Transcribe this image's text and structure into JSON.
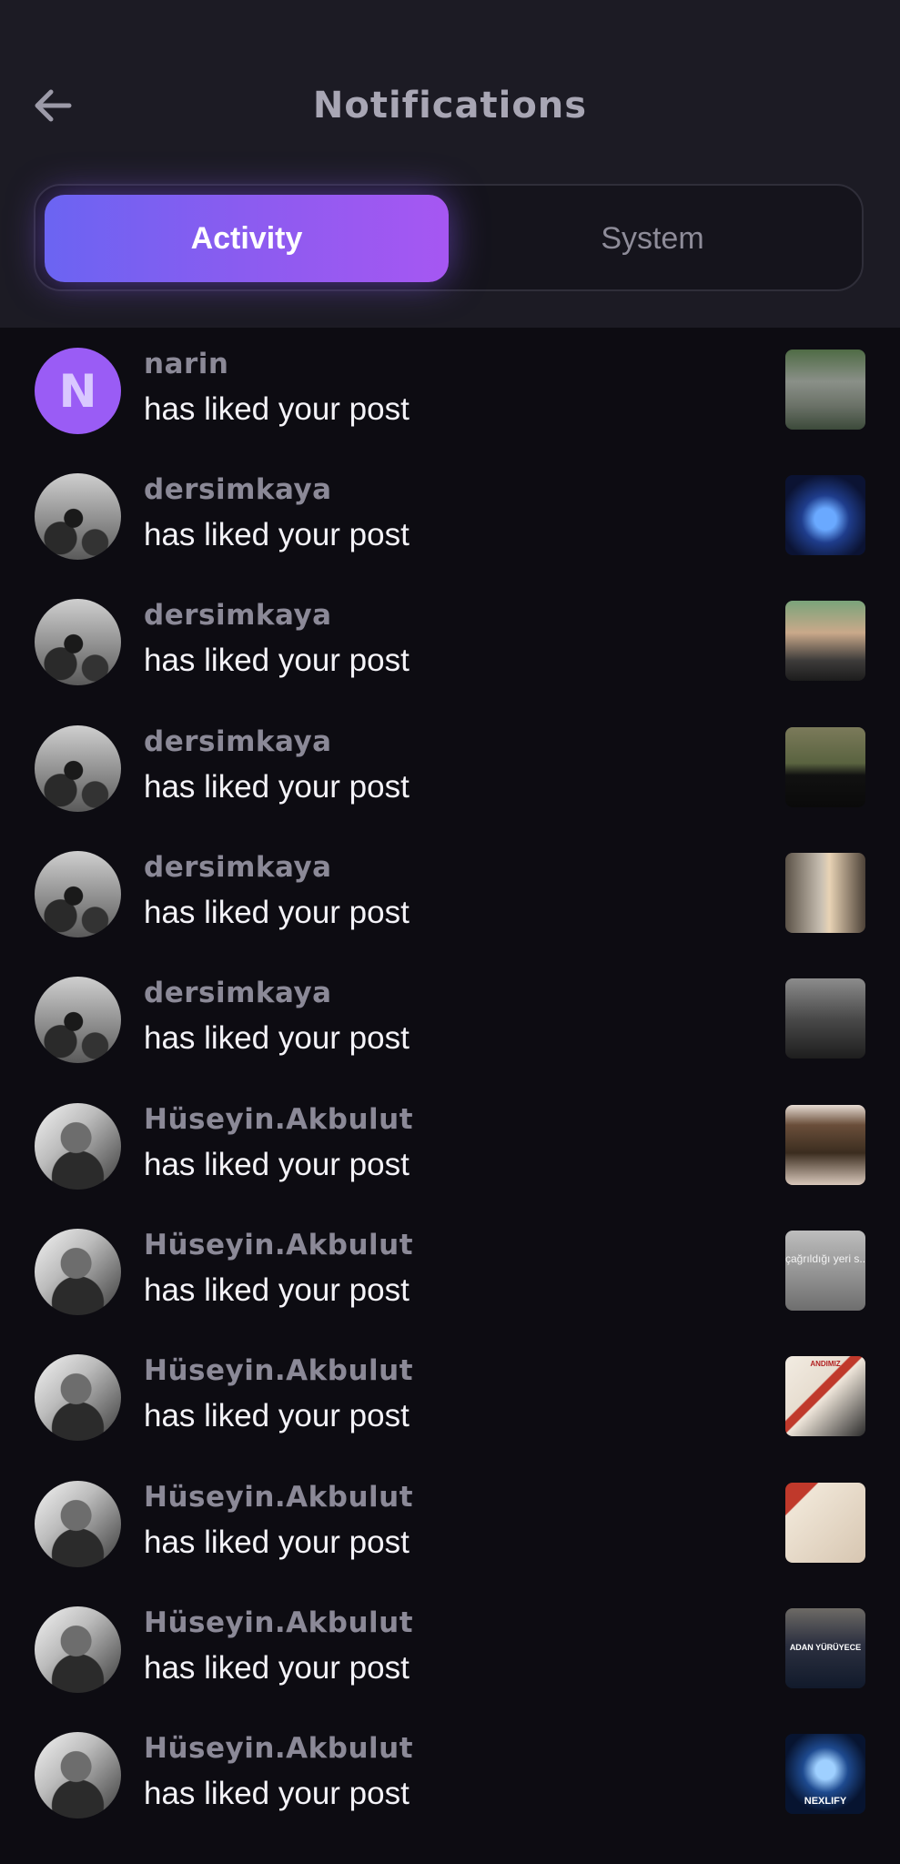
{
  "header": {
    "title": "Notifications",
    "back_icon": "arrow-left-icon"
  },
  "tabs": [
    {
      "label": "Activity",
      "active": true
    },
    {
      "label": "System",
      "active": false
    }
  ],
  "colors": {
    "accent_start": "#6b64f2",
    "accent_end": "#a657f2",
    "background": "#0d0c12",
    "header_background": "#1c1b24",
    "username": "#8b8997",
    "action_text": "#f4f3f8"
  },
  "notifications": [
    {
      "username": "narin",
      "avatar_letter": "N",
      "action": "has liked your post"
    },
    {
      "username": "dersimkaya",
      "action": "has liked your post"
    },
    {
      "username": "dersimkaya",
      "action": "has liked your post"
    },
    {
      "username": "dersimkaya",
      "action": "has liked your post"
    },
    {
      "username": "dersimkaya",
      "action": "has liked your post"
    },
    {
      "username": "dersimkaya",
      "action": "has liked your post"
    },
    {
      "username": "Hüseyin.Akbulut",
      "action": "has liked your post"
    },
    {
      "username": "Hüseyin.Akbulut",
      "action": "has liked your post",
      "thumb_caption": "çağrıldığı yeri s... için mi, işe yara..."
    },
    {
      "username": "Hüseyin.Akbulut",
      "action": "has liked your post",
      "thumb_caption": "ANDIMIZ"
    },
    {
      "username": "Hüseyin.Akbulut",
      "action": "has liked your post"
    },
    {
      "username": "Hüseyin.Akbulut",
      "action": "has liked your post",
      "thumb_caption": "ADAN YÜRÜYECE"
    },
    {
      "username": "Hüseyin.Akbulut",
      "action": "has liked your post",
      "thumb_caption": "NEXLIFY"
    }
  ]
}
